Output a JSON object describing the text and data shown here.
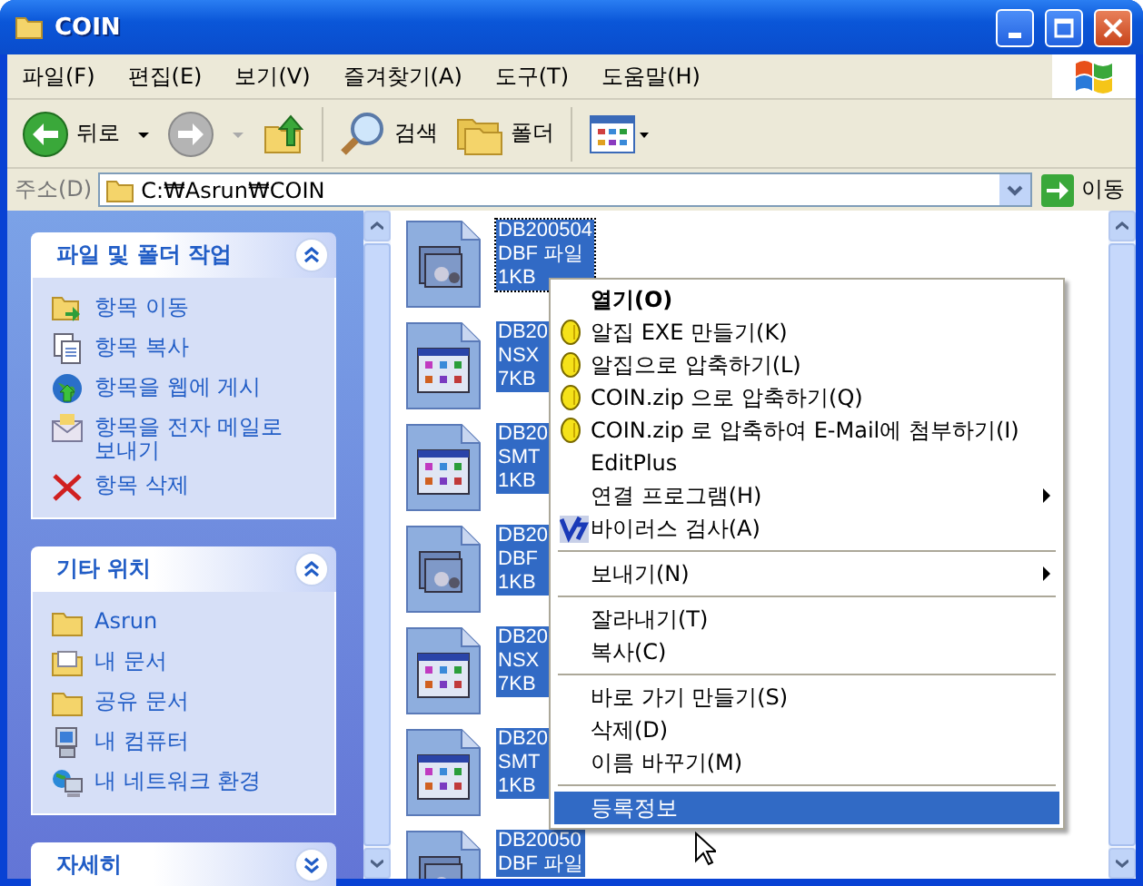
{
  "window": {
    "title": "COIN"
  },
  "menu_bar": [
    "파일(F)",
    "편집(E)",
    "보기(V)",
    "즐겨찾기(A)",
    "도구(T)",
    "도움말(H)"
  ],
  "toolbar": [
    {
      "kind": "back",
      "label": "뒤로",
      "disabled": false
    },
    {
      "kind": "forward",
      "disabled": true
    },
    {
      "kind": "up"
    },
    {
      "kind": "search",
      "label": "검색"
    },
    {
      "kind": "folders",
      "label": "폴더"
    },
    {
      "kind": "views"
    }
  ],
  "address": {
    "label": "주소(D)",
    "value": "C:₩Asrun₩COIN",
    "go": "이동"
  },
  "task_panes": [
    {
      "title": "파일 및 폴더 작업",
      "expanded": true,
      "items": [
        {
          "kind": "move",
          "label": "항목 이동"
        },
        {
          "kind": "copy",
          "label": "항목 복사"
        },
        {
          "kind": "web",
          "label": "항목을 웹에 게시"
        },
        {
          "kind": "email",
          "label": "항목을 전자 메일로 보내기"
        },
        {
          "kind": "delete",
          "label": "항목 삭제"
        }
      ]
    },
    {
      "title": "기타 위치",
      "expanded": true,
      "items": [
        {
          "kind": "folder",
          "label": "Asrun"
        },
        {
          "kind": "documents",
          "label": "내 문서"
        },
        {
          "kind": "folder",
          "label": "공유 문서"
        },
        {
          "kind": "computer",
          "label": "내 컴퓨터"
        },
        {
          "kind": "network",
          "label": "내 네트워크 환경"
        }
      ]
    },
    {
      "title": "자세히",
      "expanded": false
    }
  ],
  "files": [
    {
      "kind": "dbf",
      "lines": [
        "DB200504",
        "DBF 파일",
        "1KB"
      ],
      "selected": true
    },
    {
      "kind": "table",
      "lines": [
        "DB20",
        "NSX",
        "7KB"
      ],
      "selected": true
    },
    {
      "kind": "table",
      "lines": [
        "DB20",
        "SMT",
        "1KB"
      ],
      "selected": true
    },
    {
      "kind": "dbf",
      "lines": [
        "DB20",
        "DBF",
        "1KB"
      ],
      "selected": true
    },
    {
      "kind": "table",
      "lines": [
        "DB20",
        "NSX",
        "7KB"
      ],
      "selected": true
    },
    {
      "kind": "table",
      "lines": [
        "DB20",
        "SMT",
        "1KB"
      ],
      "selected": true
    },
    {
      "kind": "dbf",
      "lines": [
        "DB20050",
        "DBF 파일"
      ],
      "selected": true
    }
  ],
  "context_menu": [
    {
      "kind": "item",
      "label": "열기(O)",
      "bold": true,
      "selected": false
    },
    {
      "kind": "zip",
      "label": "알집 EXE 만들기(K)",
      "selected": false
    },
    {
      "kind": "zip",
      "label": "알집으로 압축하기(L)",
      "selected": false
    },
    {
      "kind": "zip",
      "label": "COIN.zip 으로 압축하기(Q)",
      "selected": false
    },
    {
      "kind": "zip",
      "label": "COIN.zip 로 압축하여 E-Mail에 첨부하기(I)",
      "selected": false
    },
    {
      "kind": "item",
      "label": "EditPlus",
      "selected": false
    },
    {
      "kind": "item",
      "label": "연결 프로그램(H)",
      "submenu": true,
      "selected": false
    },
    {
      "kind": "virus",
      "label": "바이러스 검사(A)",
      "selected": false
    },
    {
      "kind": "separator"
    },
    {
      "kind": "item",
      "label": "보내기(N)",
      "submenu": true,
      "selected": false
    },
    {
      "kind": "separator"
    },
    {
      "kind": "item",
      "label": "잘라내기(T)",
      "selected": false
    },
    {
      "kind": "item",
      "label": "복사(C)",
      "selected": false
    },
    {
      "kind": "separator"
    },
    {
      "kind": "item",
      "label": "바로 가기 만들기(S)",
      "selected": false
    },
    {
      "kind": "item",
      "label": "삭제(D)",
      "selected": false
    },
    {
      "kind": "item",
      "label": "이름 바꾸기(M)",
      "selected": false
    },
    {
      "kind": "separator"
    },
    {
      "kind": "item",
      "label": "등록정보",
      "selected": true
    }
  ]
}
